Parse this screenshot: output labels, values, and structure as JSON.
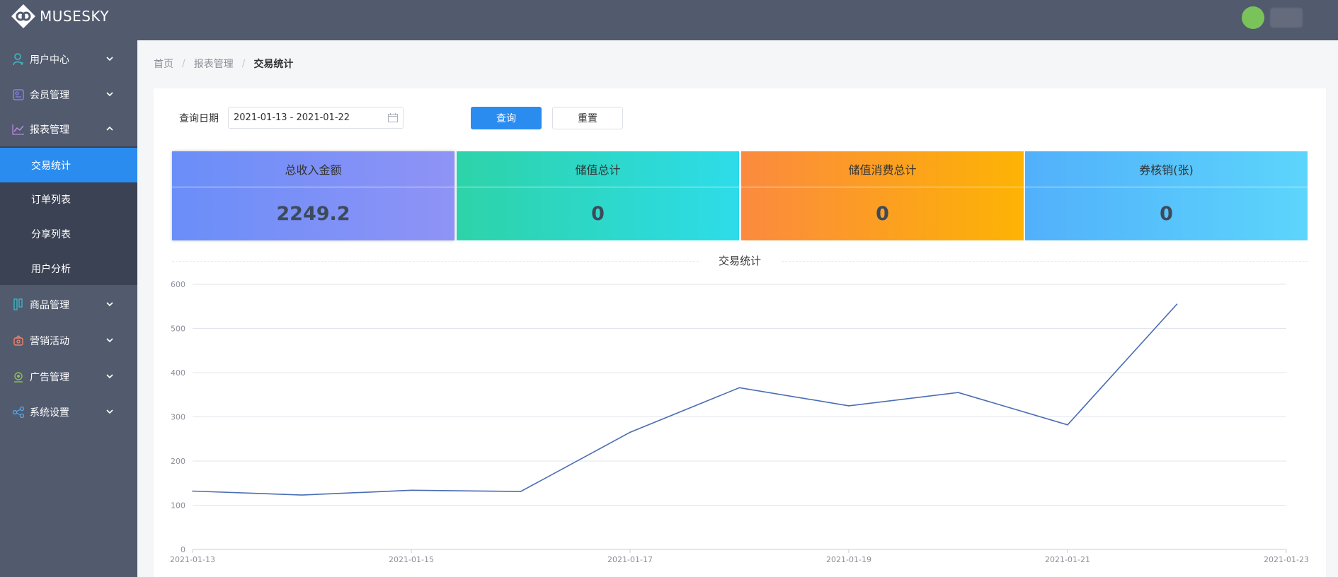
{
  "app": {
    "brand": "MUSESKY"
  },
  "colors": {
    "accent": "#2b8cf0",
    "sidebar": "#525a6e",
    "submenu": "#3b4253",
    "line": "#4a6db3"
  },
  "sidebar": {
    "items": [
      {
        "label": "用户中心",
        "icon": "user-icon"
      },
      {
        "label": "会员管理",
        "icon": "member-card-icon"
      },
      {
        "label": "报表管理",
        "icon": "line-chart-icon",
        "expanded": true,
        "children": [
          {
            "label": "交易统计",
            "active": true
          },
          {
            "label": "订单列表"
          },
          {
            "label": "分享列表"
          },
          {
            "label": "用户分析"
          }
        ]
      },
      {
        "label": "商品管理",
        "icon": "goods-icon"
      },
      {
        "label": "营销活动",
        "icon": "marketing-icon"
      },
      {
        "label": "广告管理",
        "icon": "ad-icon"
      },
      {
        "label": "系统设置",
        "icon": "settings-share-icon"
      }
    ]
  },
  "breadcrumb": {
    "home": "首页",
    "section": "报表管理",
    "current": "交易统计"
  },
  "filter": {
    "label": "查询日期",
    "date_range": "2021-01-13 - 2021-01-22",
    "query_button": "查询",
    "reset_button": "重置"
  },
  "stats": [
    {
      "title": "总收入金额",
      "value": "2249.2"
    },
    {
      "title": "储值总计",
      "value": "0"
    },
    {
      "title": "储值消费总计",
      "value": "0"
    },
    {
      "title": "券核销(张)",
      "value": "0"
    }
  ],
  "chart_data": {
    "type": "line",
    "title": "交易统计",
    "x": [
      "2021-01-13",
      "2021-01-14",
      "2021-01-15",
      "2021-01-16",
      "2021-01-17",
      "2021-01-18",
      "2021-01-19",
      "2021-01-20",
      "2021-01-21",
      "2021-01-22"
    ],
    "values": [
      132,
      123,
      134,
      131,
      265,
      366,
      325,
      355,
      282,
      555
    ],
    "x_ticks": [
      "2021-01-13",
      "2021-01-15",
      "2021-01-17",
      "2021-01-19",
      "2021-01-21",
      "2021-01-23"
    ],
    "y_ticks": [
      0,
      100,
      200,
      300,
      400,
      500,
      600
    ],
    "ylim": [
      0,
      600
    ],
    "grid": true
  }
}
